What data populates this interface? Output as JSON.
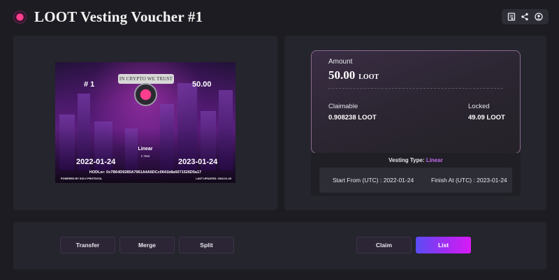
{
  "header": {
    "title": "LOOT Vesting Voucher #1",
    "actions": [
      {
        "icon": "receipt-icon"
      },
      {
        "icon": "share-icon"
      },
      {
        "icon": "profile-icon"
      }
    ]
  },
  "card": {
    "id_label": "# 1",
    "amount": "50.00",
    "ribbon_text": "IN CRYPTO WE TRUST",
    "type": "Linear",
    "duration": "1 Year",
    "start_date": "2022-01-24",
    "end_date": "2023-01-24",
    "hodler": "HODLer: 0x7B64D9285A7961A4A6DCc0641b8a5071526D5a17",
    "powered_by": "POWERED BY SOLV PROTOCOL",
    "last_updated": "LAST UPDATED: 2022-01-25"
  },
  "summary": {
    "amount_label": "Amount",
    "amount_value": "50.00",
    "amount_unit": "LOOT",
    "claimable_label": "Claimable",
    "claimable_value": "0.908238 LOOT",
    "locked_label": "Locked",
    "locked_value": "49.09 LOOT"
  },
  "vesting": {
    "type_label": "Vesting Type:",
    "type_value": "Linear",
    "start_text": "Start From (UTC) : 2022-01-24",
    "finish_text": "Finish At (UTC) : 2023-01-24"
  },
  "actions": {
    "transfer": "Transfer",
    "merge": "Merge",
    "split": "Split",
    "claim": "Claim",
    "list": "List"
  },
  "colors": {
    "accent": "#c56cf0",
    "list_gradient_start": "#5a4cf4",
    "list_gradient_end": "#d81bf6",
    "brand_pink": "#ff3f8e"
  }
}
